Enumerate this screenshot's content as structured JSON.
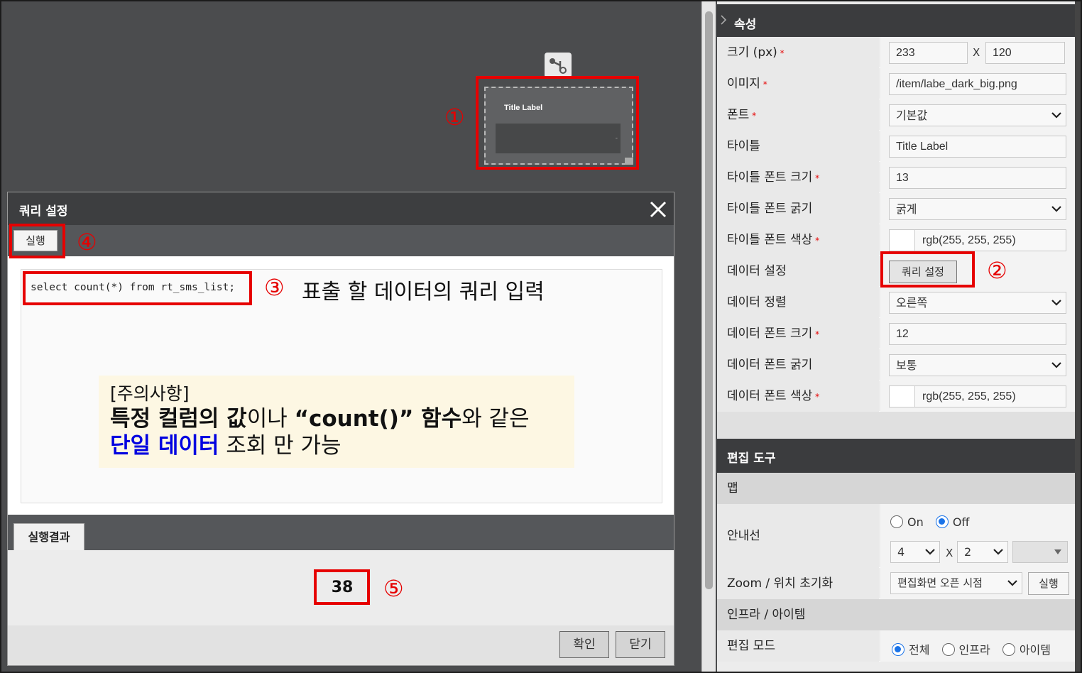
{
  "canvas": {
    "widget": {
      "title": "Title Label",
      "data_text": "-"
    },
    "markers": {
      "m1": "①",
      "m2": "②",
      "m3": "③",
      "m4": "④",
      "m5": "⑤"
    }
  },
  "dialog": {
    "title": "쿼리 설정",
    "run_label": "실행",
    "query": "select count(*) from rt_sms_list;",
    "query_note": "표출 할 데이터의 쿼리 입력",
    "notice": {
      "line1": "[주의사항]",
      "line2_bold1": "특정 컬럼의 값",
      "line2_text1": "이나 ",
      "line2_bold2": "“count()” 함수",
      "line2_text2": "와 같은",
      "line3_blue": "단일 데이터",
      "line3_text": " 조회 만 가능"
    },
    "result_tab": "실행결과",
    "result_value": "38",
    "confirm_label": "확인",
    "close_label": "닫기"
  },
  "panel": {
    "properties_title": "속성",
    "size": {
      "label": "크기 (px)",
      "width": "233",
      "x": "X",
      "height": "120"
    },
    "image": {
      "label": "이미지",
      "value": "/item/labe_dark_big.png"
    },
    "font": {
      "label": "폰트",
      "value": "기본값"
    },
    "title": {
      "label": "타이틀",
      "value": "Title Label"
    },
    "title_font_size": {
      "label": "타이틀 폰트 크기",
      "value": "13"
    },
    "title_font_weight": {
      "label": "타이틀 폰트 굵기",
      "value": "굵게"
    },
    "title_font_color": {
      "label": "타이틀 폰트 색상",
      "value": "rgb(255, 255, 255)"
    },
    "data_setting": {
      "label": "데이터 설정",
      "button": "쿼리 설정"
    },
    "data_align": {
      "label": "데이터 정렬",
      "value": "오른쪽"
    },
    "data_font_size": {
      "label": "데이터 폰트 크기",
      "value": "12"
    },
    "data_font_weight": {
      "label": "데이터 폰트 굵기",
      "value": "보통"
    },
    "data_font_color": {
      "label": "데이터 폰트 색상",
      "value": "rgb(255, 255, 255)"
    },
    "edit_tools_title": "편집 도구",
    "map_title": "맵",
    "guide": {
      "label": "안내선",
      "on": "On",
      "off": "Off",
      "cols": "4",
      "x": "X",
      "rows": "2"
    },
    "zoom": {
      "label": "Zoom / 위치 초기화",
      "value": "편집화면 오픈 시점",
      "button": "실행"
    },
    "infra_title": "인프라 / 아이템",
    "edit_mode": {
      "label": "편집 모드",
      "all": "전체",
      "infra": "인프라",
      "item": "아이템"
    }
  },
  "colors": {
    "highlight": "#e60000",
    "header": "#3b3c3e",
    "accent_blue": "#0000e0",
    "radio": "#1a73e8"
  }
}
